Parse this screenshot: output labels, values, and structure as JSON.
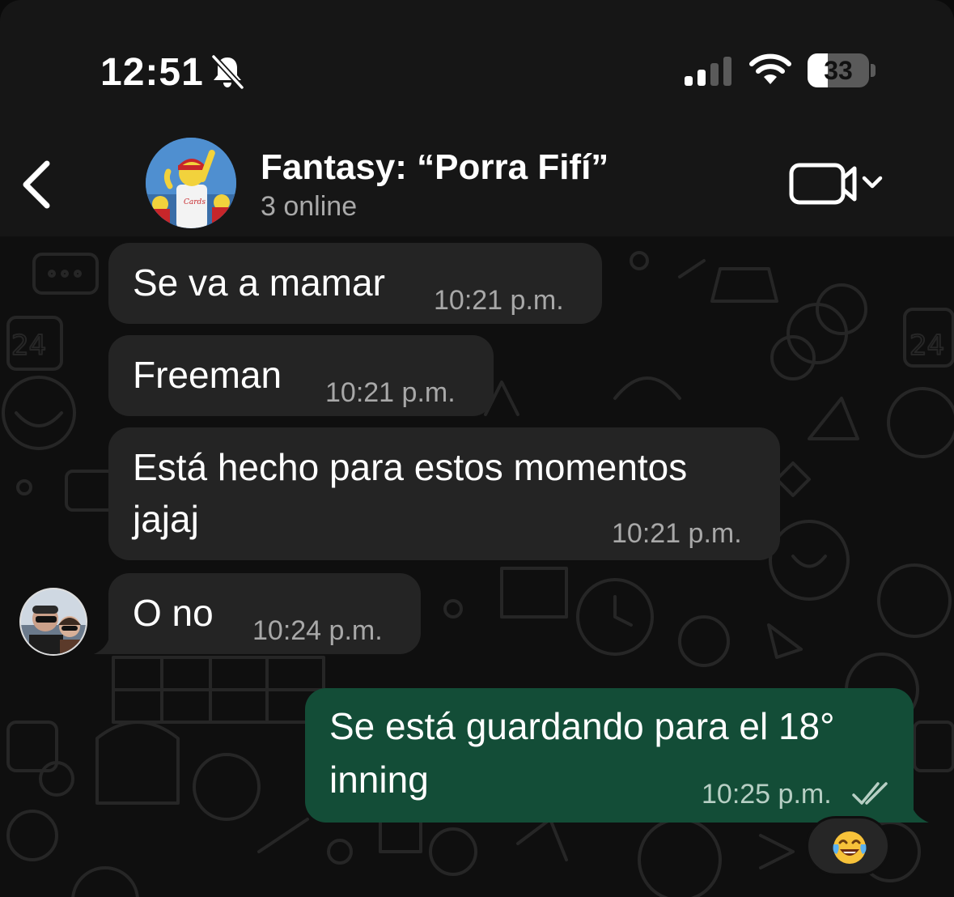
{
  "status_bar": {
    "time": "12:51",
    "battery_level": "33",
    "battery_fraction": 0.33,
    "icons": [
      "bell-off-icon",
      "signal-icon",
      "wifi-icon",
      "battery-icon"
    ]
  },
  "header": {
    "group_name": "Fantasy: “Porra Fifí”",
    "group_status": "3 online",
    "icons": [
      "back-icon",
      "group-avatar",
      "video-camera-icon",
      "chevron-down-icon"
    ]
  },
  "messages": [
    {
      "direction": "incoming",
      "text": "Se va a mamar",
      "time": "10:21 p.m."
    },
    {
      "direction": "incoming",
      "text": "Freeman",
      "time": "10:21 p.m."
    },
    {
      "direction": "incoming",
      "text_line1": "Está hecho para estos momentos",
      "text_line2": "jajaj",
      "time": "10:21 p.m."
    },
    {
      "direction": "incoming",
      "text": "O no",
      "time": "10:24 p.m.",
      "has_avatar": true
    },
    {
      "direction": "outgoing",
      "text_line1": "Se está guardando para el 18°",
      "text_line2": "inning",
      "time": "10:25 p.m.",
      "status": "read",
      "reaction": "face-with-tears-of-joy"
    }
  ],
  "colors": {
    "background": "#0f0f0f",
    "header": "#161616",
    "incoming_bubble": "#242424",
    "outgoing_bubble": "#134d37",
    "meta_text": "#a8a8a8"
  }
}
